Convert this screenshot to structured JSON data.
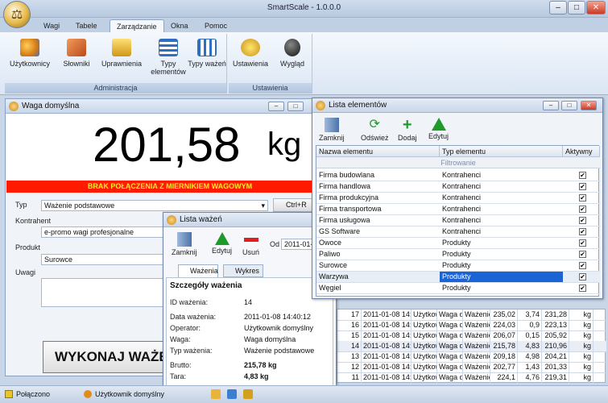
{
  "app": {
    "title": "SmartScale - 1.0.0.0"
  },
  "menu": [
    "Wagi",
    "Tabele",
    "Zarządzanie",
    "Okna",
    "Pomoc"
  ],
  "ribbon": {
    "group_admin": {
      "label": "Administracja",
      "buttons": [
        "Użytkownicy",
        "Słowniki",
        "Uprawnienia",
        "Typy elementów",
        "Typy ważeń"
      ]
    },
    "group_settings": {
      "label": "Ustawienia",
      "buttons": [
        "Ustawienia",
        "Wygląd"
      ]
    }
  },
  "scale_window": {
    "title": "Waga domyślna",
    "weight": "201,58",
    "unit": "kg",
    "alarm": "BRAK POŁĄCZENIA Z MIERNIKIEM WAGOWYM",
    "typ_label": "Typ",
    "typ_value": "Ważenie podstawowe",
    "shortcut": "Ctrl+R",
    "kontrahent_label": "Kontrahent",
    "kontrahent_value": "e-promo wagi profesjonalne",
    "produkt_label": "Produkt",
    "produkt_value": "Surowce",
    "uwagi_label": "Uwagi",
    "execute": "WYKONAJ WAŻE"
  },
  "elements_window": {
    "title": "Lista elementów",
    "toolbar": [
      "Zamknij",
      "Odśwież",
      "Dodaj",
      "Edytuj"
    ],
    "columns": [
      "Nazwa elementu",
      "Typ elementu",
      "Aktywny"
    ],
    "filter": "Filtrowanie",
    "rows": [
      {
        "name": "Firma budowlana",
        "type": "Kontrahenci"
      },
      {
        "name": "Firma handlowa",
        "type": "Kontrahenci"
      },
      {
        "name": "Firma produkcyjna",
        "type": "Kontrahenci"
      },
      {
        "name": "Firma transportowa",
        "type": "Kontrahenci"
      },
      {
        "name": "Firma usługowa",
        "type": "Kontrahenci"
      },
      {
        "name": "GS Software",
        "type": "Kontrahenci"
      },
      {
        "name": "Owoce",
        "type": "Produkty"
      },
      {
        "name": "Paliwo",
        "type": "Produkty"
      },
      {
        "name": "Surowce",
        "type": "Produkty"
      },
      {
        "name": "Warzywa",
        "type": "Produkty"
      },
      {
        "name": "Węgiel",
        "type": "Produkty"
      }
    ]
  },
  "weighings_window": {
    "title": "Lista ważeń",
    "toolbar": [
      "Zamknij",
      "Edytuj",
      "Usuń"
    ],
    "od_label": "Od",
    "od_value": "2011-01-",
    "tabs": [
      "Ważenia",
      "Wykres"
    ],
    "details_title": "Szczegóły ważenia",
    "details": [
      {
        "label": "ID ważenia:",
        "value": "14"
      },
      {
        "label": "Data ważenia:",
        "value": "2011-01-08 14:40:12"
      },
      {
        "label": "Operator:",
        "value": "Użytkownik domyślny"
      },
      {
        "label": "Waga:",
        "value": "Waga domyślna"
      },
      {
        "label": "Typ ważenia:",
        "value": "Ważenie podstawowe"
      },
      {
        "label": "Brutto:",
        "value": "215,78 kg"
      },
      {
        "label": "Tara:",
        "value": "4,83 kg"
      }
    ]
  },
  "weighings_table": {
    "rows": [
      [
        "17",
        "2011-01-08 14:",
        "Użytkow",
        "Waga d",
        "Ważenie",
        "235,02",
        "3,74",
        "231,28",
        "kg"
      ],
      [
        "16",
        "2011-01-08 14:",
        "Użytkow",
        "Waga d",
        "Ważenie",
        "224,03",
        "0,9",
        "223,13",
        "kg"
      ],
      [
        "15",
        "2011-01-08 14:",
        "Użytkow",
        "Waga d",
        "Ważenie",
        "206,07",
        "0,15",
        "205,92",
        "kg"
      ],
      [
        "14",
        "2011-01-08 14:",
        "Użytkow",
        "Waga d",
        "Ważenie",
        "215,78",
        "4,83",
        "210,96",
        "kg"
      ],
      [
        "13",
        "2011-01-08 14:",
        "Użytkow",
        "Waga d",
        "Ważenie",
        "209,18",
        "4,98",
        "204,21",
        "kg"
      ],
      [
        "12",
        "2011-01-08 14:",
        "Użytkow",
        "Waga d",
        "Ważenie",
        "202,77",
        "1,43",
        "201,33",
        "kg"
      ],
      [
        "11",
        "2011-01-08 14:",
        "Użytkow",
        "Waga d",
        "Ważenie",
        "224,1",
        "4,76",
        "219,31",
        "kg"
      ]
    ]
  },
  "status": {
    "connection": "Połączono",
    "user": "Użytkownik domyślny"
  },
  "colors": {
    "alarm_bg": "#ff1a00",
    "alarm_text": "#ffe82a",
    "selection": "#1b64d6"
  }
}
